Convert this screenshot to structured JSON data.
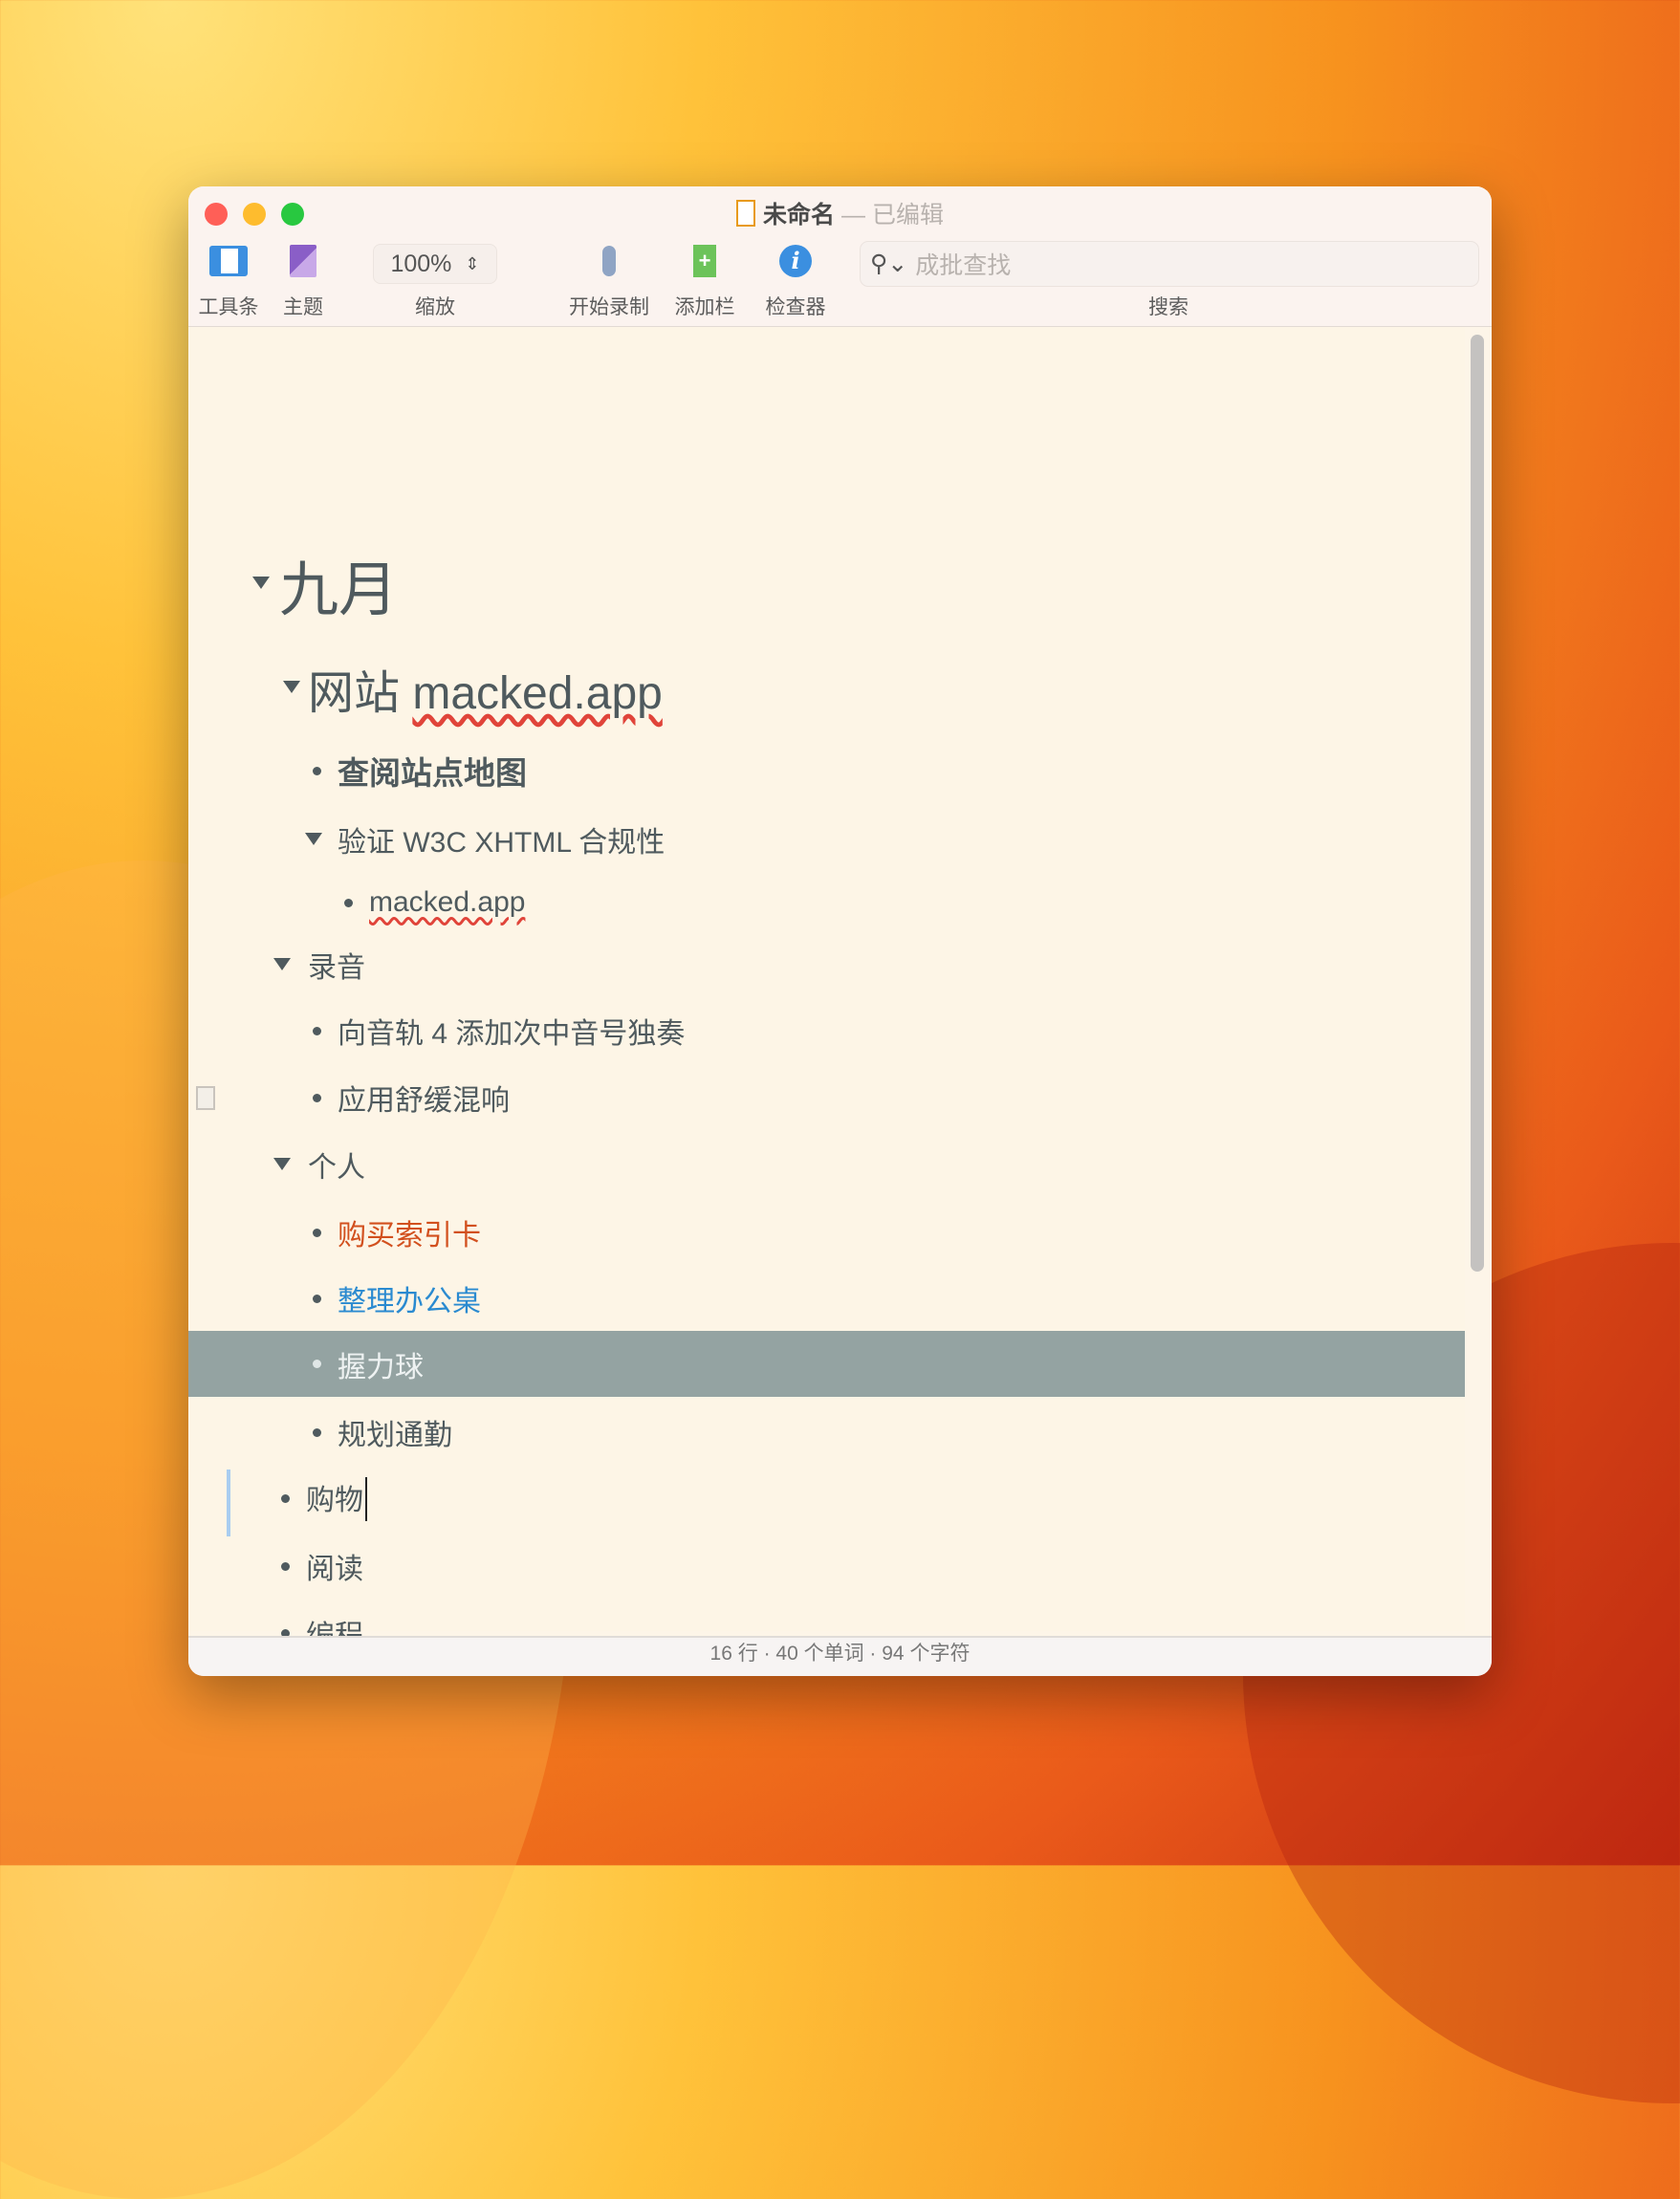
{
  "window": {
    "title": "未命名",
    "title_sep": "—",
    "title_state": "已编辑"
  },
  "toolbar": {
    "toolbar_label": "工具条",
    "theme_label": "主题",
    "zoom_value": "100%",
    "zoom_label": "缩放",
    "record_label": "开始录制",
    "add_column_label": "添加栏",
    "inspector_label": "检查器",
    "search_placeholder": "成批查找",
    "search_label": "搜索"
  },
  "outline": [
    {
      "text": "九月",
      "level": 0,
      "kind": "triangle"
    },
    {
      "text": "网站 ",
      "link": "macked.app",
      "level": 1,
      "kind": "triangle"
    },
    {
      "text": "查阅站点地图",
      "level": 2,
      "kind": "bullet",
      "bold": true
    },
    {
      "text": "验证 W3C XHTML 合规性",
      "level": 2,
      "kind": "triangle"
    },
    {
      "text": "macked.app",
      "level": 3,
      "kind": "bullet"
    },
    {
      "text": "录音",
      "level": 1,
      "kind": "triangle"
    },
    {
      "text": "向音轨 4 添加次中音号独奏",
      "level": 2,
      "kind": "bullet"
    },
    {
      "text": "应用舒缓混响",
      "level": 2,
      "kind": "bullet",
      "note": true
    },
    {
      "text": "个人",
      "level": 1,
      "kind": "triangle"
    },
    {
      "text": "购买索引卡",
      "level": 2,
      "kind": "bullet",
      "color": "#d2501e"
    },
    {
      "text": "整理办公桌",
      "level": 2,
      "kind": "bullet",
      "color": "#2a8ad0"
    },
    {
      "text": "握力球",
      "level": 2,
      "kind": "bullet",
      "selected": true
    },
    {
      "text": "规划通勤",
      "level": 2,
      "kind": "bullet"
    },
    {
      "text": "购物",
      "level": 1,
      "kind": "bullet",
      "cursor": true
    },
    {
      "text": "阅读",
      "level": 1,
      "kind": "bullet"
    },
    {
      "text": "编程",
      "level": 1,
      "kind": "bullet"
    }
  ],
  "status": {
    "text": "16 行 · 40 个单词 · 94 个字符"
  }
}
